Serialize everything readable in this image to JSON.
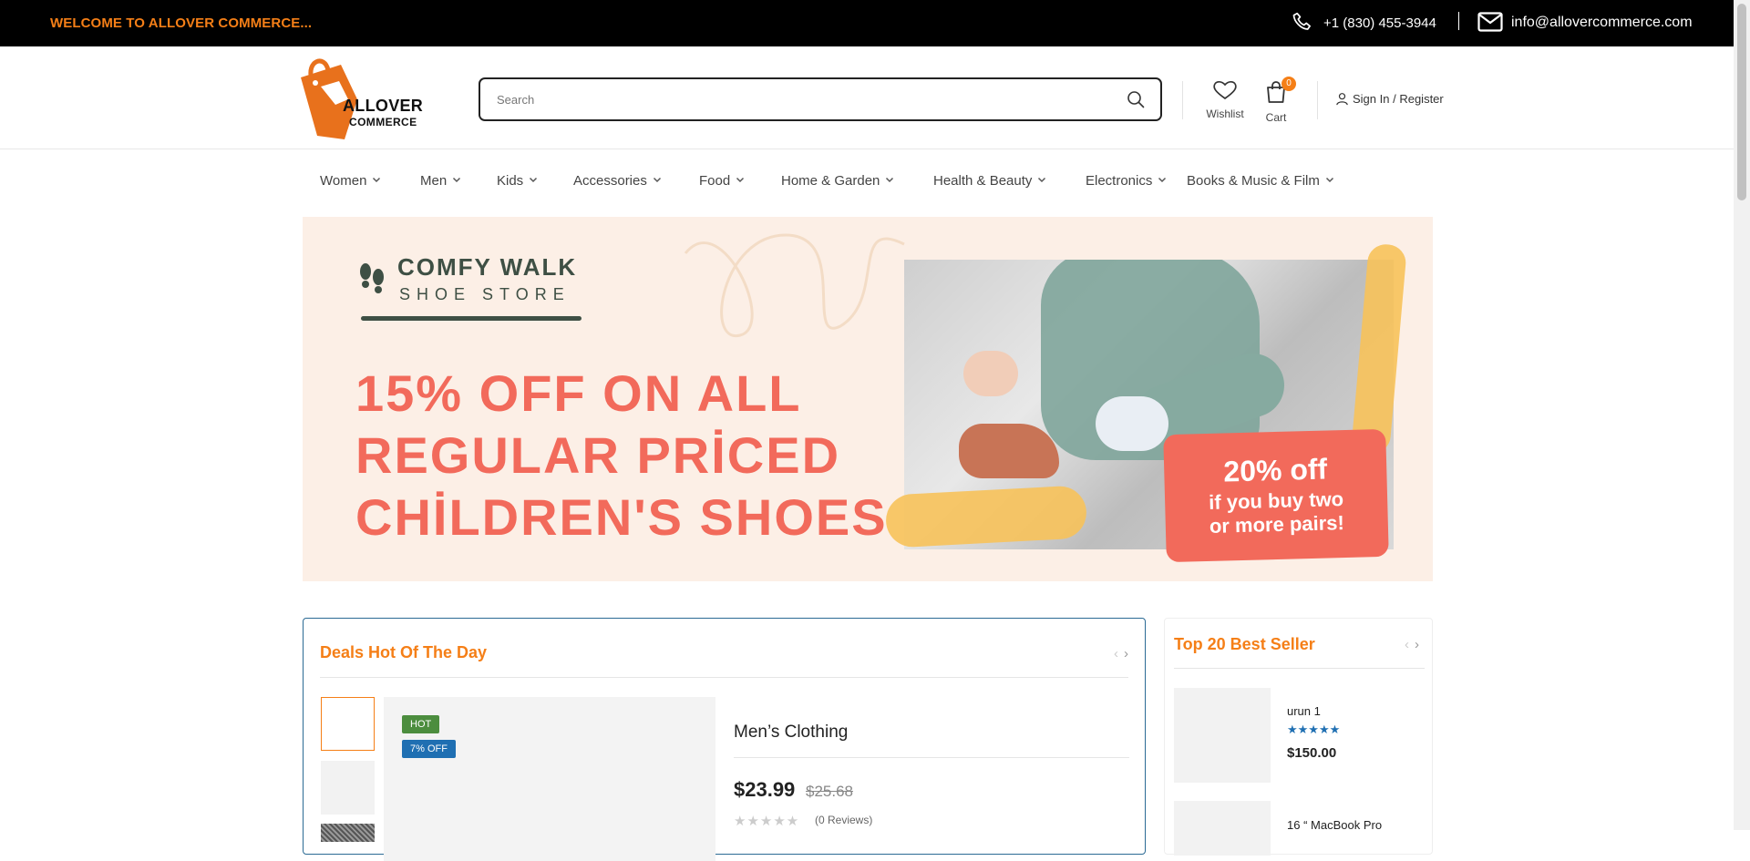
{
  "topbar": {
    "welcome": "WELCOME TO ALLOVER COMMERCE...",
    "phone": "+1 (830) 455-3944",
    "email": "info@allovercommerce.com"
  },
  "header": {
    "logo_line1": "ALLOVER",
    "logo_line2": "COMMERCE",
    "search_placeholder": "Search",
    "wishlist_label": "Wishlist",
    "cart_label": "Cart",
    "cart_count": "0",
    "signin_label": "Sign In",
    "register_label": "Register",
    "accent_color": "#f57f17"
  },
  "nav": {
    "items": [
      {
        "label": "Women"
      },
      {
        "label": "Men"
      },
      {
        "label": "Kids"
      },
      {
        "label": "Accessories"
      },
      {
        "label": "Food"
      },
      {
        "label": "Home & Garden"
      },
      {
        "label": "Health & Beauty"
      },
      {
        "label": "Electronics"
      },
      {
        "label": "Books & Music & Film"
      }
    ]
  },
  "banner": {
    "store_name": "COMFY WALK",
    "store_sub": "SHOE STORE",
    "headline_1": "15% OFF ON ALL",
    "headline_2": "REGULAR PRİCED",
    "headline_3": "CHİLDREN'S SHOES",
    "promo_big": "20% off",
    "promo_line1": "if you buy two",
    "promo_line2": "or more pairs!"
  },
  "deals": {
    "title": "Deals Hot Of The Day",
    "badge_hot": "HOT",
    "badge_off": "7% OFF",
    "product_name": "Men’s Clothing",
    "price": "$23.99",
    "old_price": "$25.68",
    "stars": "★★★★★",
    "reviews": "(0 Reviews)"
  },
  "best_seller": {
    "title": "Top 20 Best Seller",
    "items": [
      {
        "name": "urun 1",
        "stars": "★★★★★",
        "price": "$150.00"
      },
      {
        "name": "16 “ MacBook Pro"
      }
    ]
  }
}
